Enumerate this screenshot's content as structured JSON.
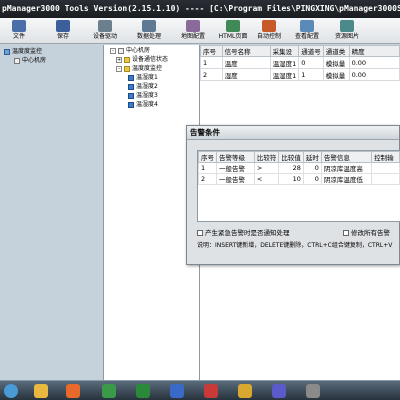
{
  "window": {
    "title": "pManager3000 Tools Version(2.15.1.10) ---- [C:\\Program Files\\PINGXING\\pManager3000Sta"
  },
  "toolbar": {
    "items": [
      {
        "label": "文件",
        "color": "#4a6ea8"
      },
      {
        "label": "保存",
        "color": "#3a5f9a"
      },
      {
        "label": "设备驱动",
        "color": "#6b7f8c"
      },
      {
        "label": "数据处理",
        "color": "#5e7a92"
      },
      {
        "label": "地图配置",
        "color": "#8a6a9a"
      },
      {
        "label": "HTML页面",
        "color": "#3f8a56"
      },
      {
        "label": "自动控制",
        "color": "#c85a2a"
      },
      {
        "label": "查看配置",
        "color": "#5a8ab8"
      },
      {
        "label": "资源图片",
        "color": "#4a8a8a"
      }
    ]
  },
  "left_tree": {
    "items": [
      {
        "label": "温度度监控"
      },
      {
        "label": "中心机房"
      }
    ]
  },
  "mid_tree": {
    "items": [
      {
        "label": "中心机房",
        "expander": "-"
      },
      {
        "label": "设备通信状态",
        "expander": "+"
      },
      {
        "label": "温度度监控",
        "expander": "-"
      },
      {
        "label": "温湿度1"
      },
      {
        "label": "温湿度2"
      },
      {
        "label": "温湿度3"
      },
      {
        "label": "温湿度4"
      }
    ]
  },
  "grid": {
    "columns": [
      "序号",
      "信号名称",
      "采集设",
      "通道号",
      "通道类",
      "精度"
    ],
    "rows": [
      [
        "1",
        "温度",
        "温湿度1",
        "0",
        "模拟量",
        "0.00"
      ],
      [
        "2",
        "湿度",
        "温湿度1",
        "1",
        "模拟量",
        "0.00"
      ]
    ]
  },
  "dialog": {
    "title": "告警条件",
    "columns": [
      "序号",
      "告警等级",
      "比较符",
      "比较值",
      "延时",
      "告警信息",
      "控制输"
    ],
    "rows": [
      [
        "1",
        "一般告警",
        ">",
        "28",
        "0",
        "阴凉库温度高",
        ""
      ],
      [
        "2",
        "一般告警",
        "<",
        "10",
        "0",
        "阴凉库温度低",
        ""
      ]
    ],
    "checkbox1": "产生紧急告警时是否通知处理",
    "checkbox2": "修改所有告警",
    "note": "说明：INSERT键新增，DELETE键删除，CTRL+C组合键复制，CTRL+V"
  },
  "taskbar": {
    "icons": [
      {
        "name": "start-icon",
        "color": "#4a9ad8"
      },
      {
        "name": "folder-icon",
        "color": "#e8b840"
      },
      {
        "name": "media-icon",
        "color": "#e86a2a"
      },
      {
        "name": "browser-icon",
        "color": "#3a9a4a"
      },
      {
        "name": "excel-icon",
        "color": "#2a8a3a"
      },
      {
        "name": "app1-icon",
        "color": "#3a6ac8"
      },
      {
        "name": "app2-icon",
        "color": "#c83a3a"
      },
      {
        "name": "app3-icon",
        "color": "#d8a830"
      },
      {
        "name": "app4-icon",
        "color": "#5a5ac8"
      },
      {
        "name": "app5-icon",
        "color": "#8a8a8a"
      }
    ]
  }
}
